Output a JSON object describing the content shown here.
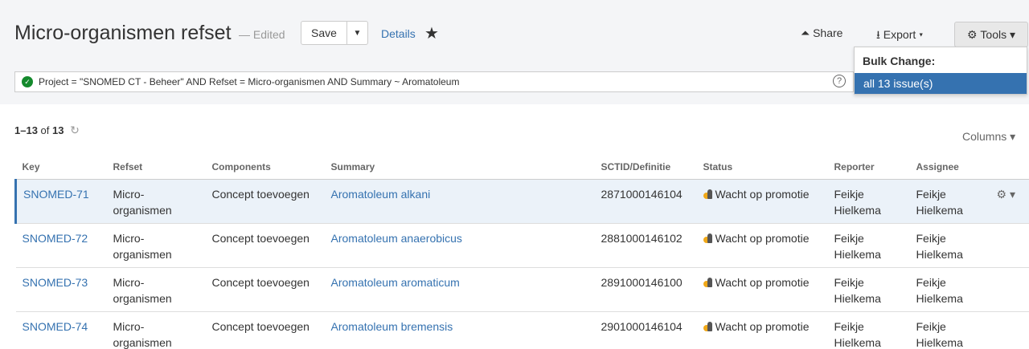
{
  "header": {
    "title": "Micro-organismen refset",
    "edited": "— Edited",
    "save_label": "Save",
    "details_label": "Details",
    "share_label": "Share",
    "export_label": "Export",
    "tools_label": "Tools"
  },
  "query": {
    "text": "Project = \"SNOMED CT - Beheer\" AND Refset = Micro-organismen AND Summary ~ Aromatoleum"
  },
  "tools_menu": {
    "heading": "Bulk Change:",
    "item": "all 13 issue(s)"
  },
  "results": {
    "range": "1–13",
    "of_label": "of",
    "total": "13",
    "columns_label": "Columns"
  },
  "table": {
    "headers": [
      "Key",
      "Refset",
      "Components",
      "Summary",
      "SCTID/Definitie",
      "Status",
      "Reporter",
      "Assignee"
    ],
    "rows": [
      {
        "key": "SNOMED-71",
        "refset_1": "Micro-",
        "refset_2": "organismen",
        "components": "Concept toevoegen",
        "summary": "Aromatoleum alkani",
        "sctid": "2871000146104",
        "status": "Wacht op promotie",
        "reporter_1": "Feikje",
        "reporter_2": "Hielkema",
        "assignee_1": "Feikje",
        "assignee_2": "Hielkema"
      },
      {
        "key": "SNOMED-72",
        "refset_1": "Micro-",
        "refset_2": "organismen",
        "components": "Concept toevoegen",
        "summary": "Aromatoleum anaerobicus",
        "sctid": "2881000146102",
        "status": "Wacht op promotie",
        "reporter_1": "Feikje",
        "reporter_2": "Hielkema",
        "assignee_1": "Feikje",
        "assignee_2": "Hielkema"
      },
      {
        "key": "SNOMED-73",
        "refset_1": "Micro-",
        "refset_2": "organismen",
        "components": "Concept toevoegen",
        "summary": "Aromatoleum aromaticum",
        "sctid": "2891000146100",
        "status": "Wacht op promotie",
        "reporter_1": "Feikje",
        "reporter_2": "Hielkema",
        "assignee_1": "Feikje",
        "assignee_2": "Hielkema"
      },
      {
        "key": "SNOMED-74",
        "refset_1": "Micro-",
        "refset_2": "organismen",
        "components": "Concept toevoegen",
        "summary": "Aromatoleum bremensis",
        "sctid": "2901000146104",
        "status": "Wacht op promotie",
        "reporter_1": "Feikje",
        "reporter_2": "Hielkema",
        "assignee_1": "Feikje",
        "assignee_2": "Hielkema"
      }
    ]
  },
  "colors": {
    "link": "#3572b0",
    "selected_row": "#ebf2f9",
    "status_ok": "#14892c"
  }
}
